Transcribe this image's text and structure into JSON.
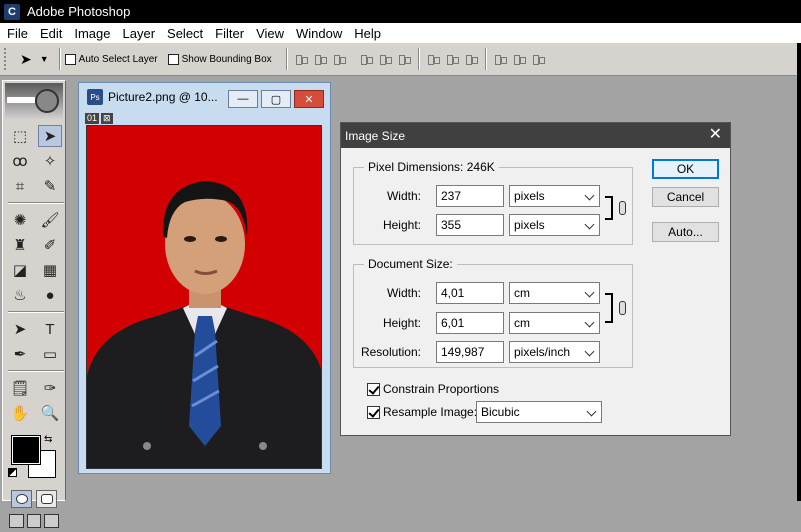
{
  "app": {
    "title": "Adobe Photoshop",
    "icon_letter": "C"
  },
  "menu": [
    "File",
    "Edit",
    "Image",
    "Layer",
    "Select",
    "Filter",
    "View",
    "Window",
    "Help"
  ],
  "options_bar": {
    "auto_select_layer": "Auto Select Layer",
    "show_bounding_box": "Show Bounding Box"
  },
  "document": {
    "title": "Picture2.png @ 10...",
    "indicator_left": "01",
    "indicator_right": "⊠",
    "minimize": "—",
    "maximize": "▢",
    "close": "✕"
  },
  "dialog": {
    "title": "Image Size",
    "pixel_dimensions": {
      "legend": "Pixel Dimensions:",
      "size": "246K",
      "width_label": "Width:",
      "width_value": "237",
      "width_unit": "pixels",
      "height_label": "Height:",
      "height_value": "355",
      "height_unit": "pixels"
    },
    "document_size": {
      "legend": "Document Size:",
      "width_label": "Width:",
      "width_value": "4,01",
      "width_unit": "cm",
      "height_label": "Height:",
      "height_value": "6,01",
      "height_unit": "cm",
      "resolution_label": "Resolution:",
      "resolution_value": "149,987",
      "resolution_unit": "pixels/inch"
    },
    "constrain_proportions": "Constrain Proportions",
    "resample_image": "Resample Image:",
    "resample_method": "Bicubic",
    "buttons": {
      "ok": "OK",
      "cancel": "Cancel",
      "auto": "Auto..."
    }
  },
  "colors": {
    "canvas_red": "#d20000",
    "dialog_titlebar": "#404040",
    "ok_accent": "#0078d7"
  }
}
